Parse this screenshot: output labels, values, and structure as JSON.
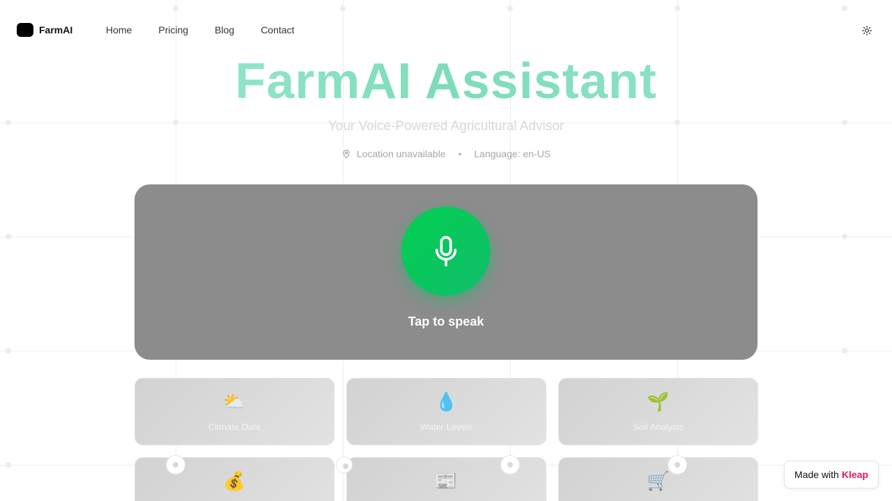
{
  "nav": {
    "brand": "FarmAI",
    "links": [
      {
        "label": "Home"
      },
      {
        "label": "Pricing"
      },
      {
        "label": "Blog"
      },
      {
        "label": "Contact"
      }
    ],
    "theme_icon": "sun-icon"
  },
  "hero": {
    "title": "FarmAI Assistant",
    "subtitle": "Your Voice-Powered Agricultural Advisor",
    "location_icon": "map-pin-icon",
    "location": "Location unavailable",
    "separator": "•",
    "language": "Language: en-US"
  },
  "voice": {
    "mic_icon": "microphone-icon",
    "label": "Tap to speak"
  },
  "features": [
    {
      "icon": "⛅",
      "icon_name": "sun-cloud-icon",
      "label": "Climate Data"
    },
    {
      "icon": "💧",
      "icon_name": "water-drop-icon",
      "label": "Water Levels"
    },
    {
      "icon": "🌱",
      "icon_name": "seedling-icon",
      "label": "Soil Analysis"
    },
    {
      "icon": "💰",
      "icon_name": "money-bag-icon",
      "label": ""
    },
    {
      "icon": "📰",
      "icon_name": "newspaper-icon",
      "label": ""
    },
    {
      "icon": "🛒",
      "icon_name": "shopping-cart-icon",
      "label": ""
    }
  ],
  "badge": {
    "prefix": "Made with",
    "brand": "Kleap"
  },
  "colors": {
    "accent_green": "#00c853",
    "panel_gray": "#8c8c8c",
    "title_gradient_start": "#a4eed6",
    "title_gradient_end": "#7edcb8",
    "badge_brand": "#e8175d"
  }
}
